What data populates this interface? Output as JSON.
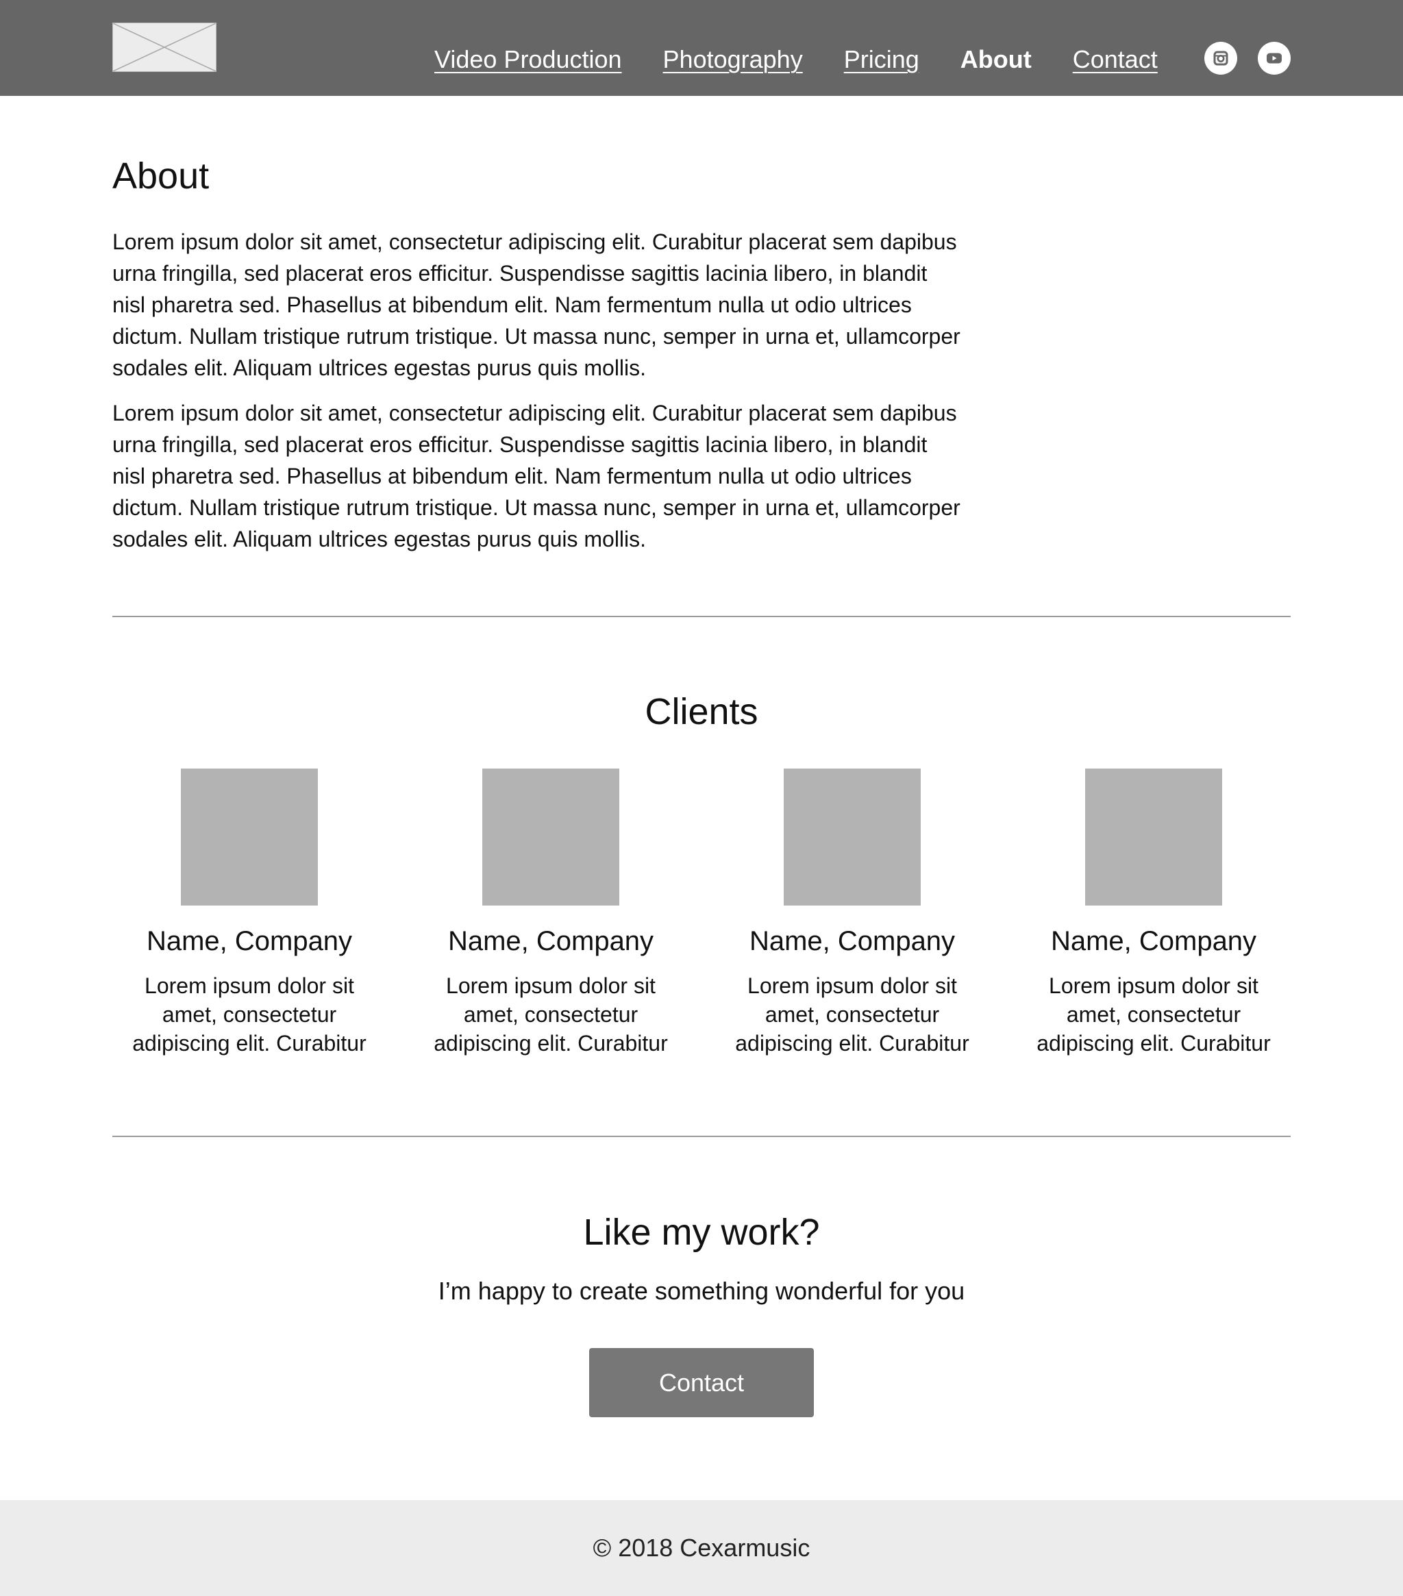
{
  "header": {
    "nav": [
      {
        "label": "Video Production",
        "active": false
      },
      {
        "label": "Photography",
        "active": false
      },
      {
        "label": "Pricing",
        "active": false
      },
      {
        "label": "About",
        "active": true
      },
      {
        "label": "Contact",
        "active": false
      }
    ],
    "social_icons": [
      "instagram-icon",
      "youtube-icon"
    ],
    "logo_icon": "image-placeholder-icon"
  },
  "about": {
    "title": "About",
    "paragraphs": [
      "Lorem ipsum dolor sit amet, consectetur adipiscing elit. Curabitur placerat sem dapibus urna fringilla, sed placerat eros efficitur. Suspendisse sagittis lacinia libero, in blandit nisl pharetra sed. Phasellus at bibendum elit. Nam fermentum nulla ut odio ultrices dictum. Nullam tristique rutrum tristique. Ut massa nunc, semper in urna et, ullamcorper sodales elit. Aliquam ultrices egestas purus quis mollis.",
      "Lorem ipsum dolor sit amet, consectetur adipiscing elit. Curabitur placerat sem dapibus urna fringilla, sed placerat eros efficitur. Suspendisse sagittis lacinia libero, in blandit nisl pharetra sed. Phasellus at bibendum elit. Nam fermentum nulla ut odio ultrices dictum. Nullam tristique rutrum tristique. Ut massa nunc, semper in urna et, ullamcorper sodales elit. Aliquam ultrices egestas purus quis mollis."
    ]
  },
  "clients": {
    "title": "Clients",
    "items": [
      {
        "name": "Name, Company",
        "text": "Lorem ipsum dolor sit amet, consectetur adipiscing elit. Curabitur"
      },
      {
        "name": "Name, Company",
        "text": "Lorem ipsum dolor sit amet, consectetur adipiscing elit. Curabitur"
      },
      {
        "name": "Name, Company",
        "text": "Lorem ipsum dolor sit amet, consectetur adipiscing elit. Curabitur"
      },
      {
        "name": "Name, Company",
        "text": "Lorem ipsum dolor sit amet, consectetur adipiscing elit. Curabitur"
      }
    ]
  },
  "cta": {
    "title": "Like my work?",
    "subtitle": "I’m happy to create something wonderful for you",
    "button_label": "Contact"
  },
  "footer": {
    "text": "© 2018 Cexarmusic"
  },
  "colors": {
    "header_bg": "#666666",
    "button_bg": "#777777",
    "footer_bg": "#ececec",
    "placeholder": "#b3b3b3",
    "divider": "#9a9a9a"
  }
}
